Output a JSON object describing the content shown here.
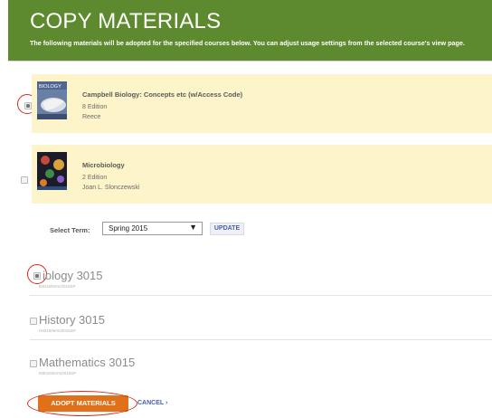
{
  "header": {
    "title": "COPY MATERIALS",
    "subtitle": "The following materials will be adopted for the specified courses below. You can adjust usage settings from the selected course's view page."
  },
  "materials": [
    {
      "title": "Campbell Biology: Concepts etc (w/Access Code)",
      "edition": "8 Edition",
      "author": "Reece",
      "checked": true
    },
    {
      "title": "Microbiology",
      "edition": "2 Edition",
      "author": "Joan L. Slonczewski",
      "checked": false
    }
  ],
  "term": {
    "label": "Select Term:",
    "selected": "Spring 2015",
    "update_label": "UPDATE"
  },
  "courses": [
    {
      "name": "iology 3015",
      "sub": "B3015/term/2015SP",
      "checked": true
    },
    {
      "name": "History 3015",
      "sub": "H3015/term/2015SP",
      "checked": false
    },
    {
      "name": "Mathematics 3015",
      "sub": "M3015/term/2015SP",
      "checked": false
    }
  ],
  "actions": {
    "adopt_label": "ADOPT MATERIALS",
    "cancel_label": "CANCEL ›"
  },
  "colors": {
    "header_bg": "#5d8a2e",
    "material_bg": "#fdf4c9",
    "accent": "#e0701a",
    "link": "#4a61a8",
    "highlight_ring": "#d42a1c"
  }
}
